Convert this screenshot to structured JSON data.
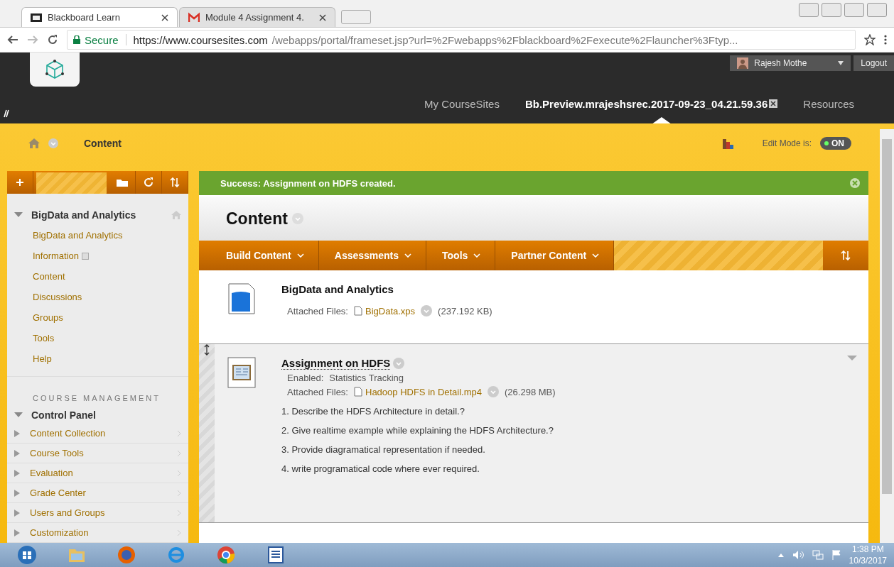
{
  "browser": {
    "tabs": [
      {
        "title": "Blackboard Learn",
        "selected": true
      },
      {
        "title": "Module 4 Assignment 4.",
        "selected": false
      }
    ],
    "secure_label": "Secure",
    "url_host": "https://www.coursesites.com",
    "url_path": "/webapps/portal/frameset.jsp?url=%2Fwebapps%2Fblackboard%2Fexecute%2Flauncher%3Ftyp..."
  },
  "header": {
    "user": "Rajesh Mothe",
    "logout": "Logout",
    "nav": [
      {
        "label": "My CourseSites",
        "selected": false
      },
      {
        "label": "Bb.Preview.mrajeshsrec.2017-09-23_04.21.59.36",
        "selected": true
      },
      {
        "label": "Resources",
        "selected": false
      }
    ]
  },
  "breadcrumb": {
    "label": "Content",
    "edit_mode_label": "Edit Mode is:",
    "edit_toggle": {
      "label": "ON",
      "on": true
    }
  },
  "sidebar": {
    "course": "BigData and Analytics",
    "items": [
      {
        "label": "BigData and Analytics",
        "has_icon": false
      },
      {
        "label": "Information",
        "has_icon": true
      },
      {
        "label": "Content",
        "has_icon": false
      },
      {
        "label": "Discussions",
        "has_icon": false
      },
      {
        "label": "Groups",
        "has_icon": false
      },
      {
        "label": "Tools",
        "has_icon": false
      },
      {
        "label": "Help",
        "has_icon": false
      }
    ],
    "management_heading": "COURSE MANAGEMENT",
    "control_panel": "Control Panel",
    "panel_items": [
      {
        "label": "Content Collection",
        "expanded": false
      },
      {
        "label": "Course Tools",
        "expanded": false
      },
      {
        "label": "Evaluation",
        "expanded": false
      },
      {
        "label": "Grade Center",
        "expanded": false
      },
      {
        "label": "Users and Groups",
        "expanded": false
      },
      {
        "label": "Customization",
        "expanded": false
      }
    ]
  },
  "success_message": "Success: Assignment on HDFS created.",
  "content": {
    "title": "Content",
    "menus": [
      "Build Content",
      "Assessments",
      "Tools",
      "Partner Content"
    ],
    "items": [
      {
        "kind": "document",
        "selected": false,
        "title": "BigData and Analytics",
        "files_label": "Attached Files:",
        "file": "BigData.xps",
        "size": "(237.192 KB)"
      },
      {
        "kind": "assignment",
        "selected": true,
        "title": "Assignment on HDFS",
        "enabled": {
          "label": "Enabled:",
          "value": "Statistics Tracking"
        },
        "files_label": "Attached Files:",
        "file": "Hadoop HDFS in Detail.mp4",
        "size": "(26.298 MB)",
        "lines": [
          "1. Describe the HDFS Architecture in detail.?",
          "2. Give realtime example while explaining the HDFS Architecture.?",
          "3. Provide diagramatical representation if needed.",
          "4. write programatical code where ever required."
        ]
      }
    ]
  },
  "taskbar": {
    "time": "1:38 PM",
    "date": "10/3/2017"
  }
}
